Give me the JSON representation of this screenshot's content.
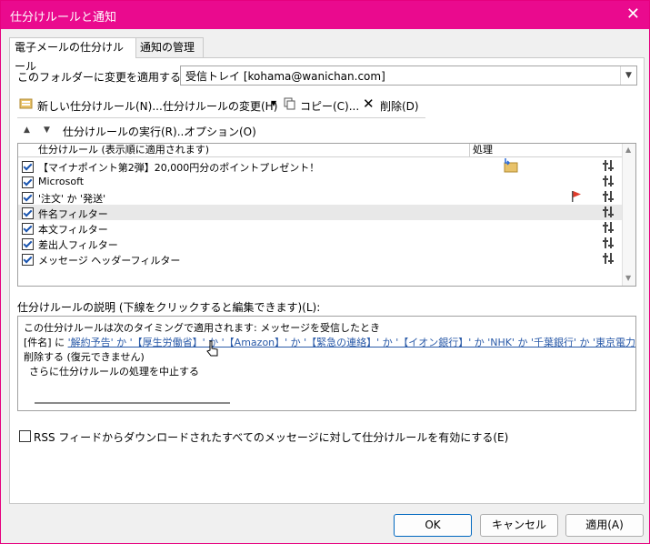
{
  "window": {
    "title": "仕分けルールと通知",
    "close_glyph": "✕"
  },
  "tabs": [
    {
      "label": "電子メールの仕分けルール",
      "active": true
    },
    {
      "label": "通知の管理",
      "active": false
    }
  ],
  "folder": {
    "label": "このフォルダーに変更を適用する(F):",
    "value": "受信トレイ [kohama@wanichan.com]"
  },
  "toolbar": {
    "new_rule": "新しい仕分けルール(N)...",
    "change_rule": "仕分けルールの変更(H)",
    "copy": "コピー(C)...",
    "delete": "削除(D)",
    "run_rules": "仕分けルールの実行(R)...",
    "options": "オプション(O)"
  },
  "list": {
    "col_rule": "仕分けルール (表示順に適用されます)",
    "col_action": "処理",
    "rows": [
      {
        "label": "【マイナポイント第2弾】20,000円分のポイントプレゼント！",
        "checked": true,
        "selected": false,
        "action_icon": "move-to-folder-icon"
      },
      {
        "label": "Microsoft",
        "checked": true,
        "selected": false,
        "action_icon": ""
      },
      {
        "label": "'注文' か '発送'",
        "checked": true,
        "selected": false,
        "action_icon": "flag-icon"
      },
      {
        "label": "件名フィルター",
        "checked": true,
        "selected": true,
        "action_icon": ""
      },
      {
        "label": "本文フィルター",
        "checked": true,
        "selected": false,
        "action_icon": ""
      },
      {
        "label": "差出人フィルター",
        "checked": true,
        "selected": false,
        "action_icon": ""
      },
      {
        "label": "メッセージ ヘッダーフィルター",
        "checked": true,
        "selected": false,
        "action_icon": ""
      }
    ]
  },
  "description": {
    "label": "仕分けルールの説明 (下線をクリックすると編集できます)(L):",
    "line1": "この仕分けルールは次のタイミングで適用されます: メッセージを受信したとき",
    "line2_prefix": "[件名] に ",
    "line2_link": "'解約予告' か '【厚生労働省】' か '【Amazon】' か '【緊急の連絡】' か '【イオン銀行】' か 'NHK' か '千葉銀行' か '東京電力' か",
    "line3": "削除する (復元できません)",
    "line4": "さらに仕分けルールの処理を中止する"
  },
  "rss": {
    "label": "RSS フィードからダウンロードされたすべてのメッセージに対して仕分けルールを有効にする(E)"
  },
  "buttons": {
    "ok": "OK",
    "cancel": "キャンセル",
    "apply": "適用(A)"
  },
  "colors": {
    "title_bar": "#ea0a8e",
    "link": "#2a5aa8",
    "check": "#1a55b0",
    "flag": "#e03c2c",
    "folder": "#e8c26a"
  }
}
